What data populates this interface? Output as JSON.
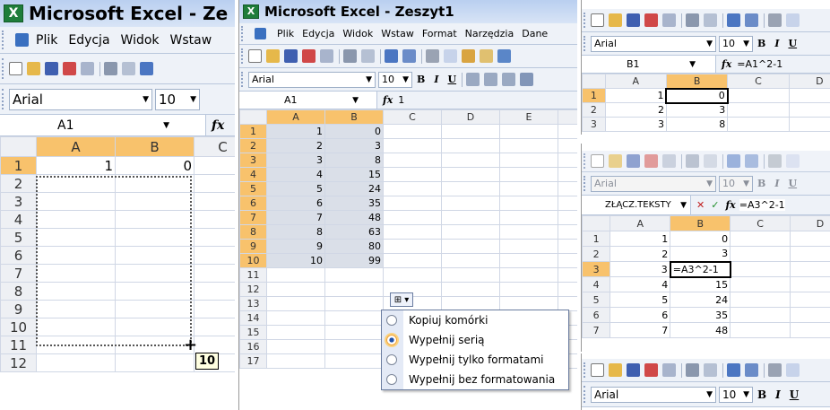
{
  "panel1": {
    "title": "Microsoft Excel - Ze",
    "menu": [
      "Plik",
      "Edycja",
      "Widok",
      "Wstaw"
    ],
    "font": "Arial",
    "size": "10",
    "namebox": "A1",
    "fx": "fx",
    "cols": [
      "A",
      "B",
      "C"
    ],
    "rows": [
      {
        "n": "1",
        "a": "1",
        "b": "0"
      },
      {
        "n": "2",
        "a": "",
        "b": ""
      },
      {
        "n": "3",
        "a": "",
        "b": ""
      },
      {
        "n": "4",
        "a": "",
        "b": ""
      },
      {
        "n": "5",
        "a": "",
        "b": ""
      },
      {
        "n": "6",
        "a": "",
        "b": ""
      },
      {
        "n": "7",
        "a": "",
        "b": ""
      },
      {
        "n": "8",
        "a": "",
        "b": ""
      },
      {
        "n": "9",
        "a": "",
        "b": ""
      },
      {
        "n": "10",
        "a": "",
        "b": ""
      },
      {
        "n": "11",
        "a": "",
        "b": ""
      },
      {
        "n": "12",
        "a": "",
        "b": ""
      }
    ],
    "tooltip": "10"
  },
  "panel2": {
    "title": "Microsoft Excel - Zeszyt1",
    "menu": [
      "Plik",
      "Edycja",
      "Widok",
      "Wstaw",
      "Format",
      "Narzędzia",
      "Dane"
    ],
    "font": "Arial",
    "size": "10",
    "namebox": "A1",
    "formula": "1",
    "cols": [
      "A",
      "B",
      "C",
      "D",
      "E"
    ],
    "rows": [
      {
        "n": "1",
        "a": "1",
        "b": "0"
      },
      {
        "n": "2",
        "a": "2",
        "b": "3"
      },
      {
        "n": "3",
        "a": "3",
        "b": "8"
      },
      {
        "n": "4",
        "a": "4",
        "b": "15"
      },
      {
        "n": "5",
        "a": "5",
        "b": "24"
      },
      {
        "n": "6",
        "a": "6",
        "b": "35"
      },
      {
        "n": "7",
        "a": "7",
        "b": "48"
      },
      {
        "n": "8",
        "a": "8",
        "b": "63"
      },
      {
        "n": "9",
        "a": "9",
        "b": "80"
      },
      {
        "n": "10",
        "a": "10",
        "b": "99"
      },
      {
        "n": "11",
        "a": "",
        "b": ""
      },
      {
        "n": "12",
        "a": "",
        "b": ""
      },
      {
        "n": "13",
        "a": "",
        "b": ""
      },
      {
        "n": "14",
        "a": "",
        "b": ""
      },
      {
        "n": "15",
        "a": "",
        "b": ""
      },
      {
        "n": "16",
        "a": "",
        "b": ""
      },
      {
        "n": "17",
        "a": "",
        "b": ""
      }
    ],
    "autofill_menu": [
      "Kopiuj komórki",
      "Wypełnij serią",
      "Wypełnij tylko formatami",
      "Wypełnij bez formatowania"
    ],
    "autofill_selected_index": 1
  },
  "panel3": {
    "font": "Arial",
    "size": "10",
    "namebox": "B1",
    "formula": "=A1^2-1",
    "cols": [
      "A",
      "B",
      "C",
      "D"
    ],
    "rows": [
      {
        "n": "1",
        "a": "1",
        "b": "0"
      },
      {
        "n": "2",
        "a": "2",
        "b": "3"
      },
      {
        "n": "3",
        "a": "3",
        "b": "8"
      }
    ]
  },
  "panel4": {
    "font": "Arial",
    "size": "10",
    "namebox": "ZŁĄCZ.TEKSTY",
    "cancel": "✕",
    "enter": "✓",
    "formula": "=A3^2-1",
    "cols": [
      "A",
      "B",
      "C",
      "D"
    ],
    "rows": [
      {
        "n": "1",
        "a": "1",
        "b": "0"
      },
      {
        "n": "2",
        "a": "2",
        "b": "3"
      },
      {
        "n": "3",
        "a": "3",
        "b": "=A3^2-1"
      },
      {
        "n": "4",
        "a": "4",
        "b": "15"
      },
      {
        "n": "5",
        "a": "5",
        "b": "24"
      },
      {
        "n": "6",
        "a": "6",
        "b": "35"
      },
      {
        "n": "7",
        "a": "7",
        "b": "48"
      }
    ]
  },
  "panel5": {
    "font": "Arial",
    "size": "10"
  },
  "colors": {
    "title_bar": "#b9cff0",
    "header_selected": "#f8c26c",
    "selection": "#dadfe8",
    "toolbar": "#eef2f8"
  }
}
